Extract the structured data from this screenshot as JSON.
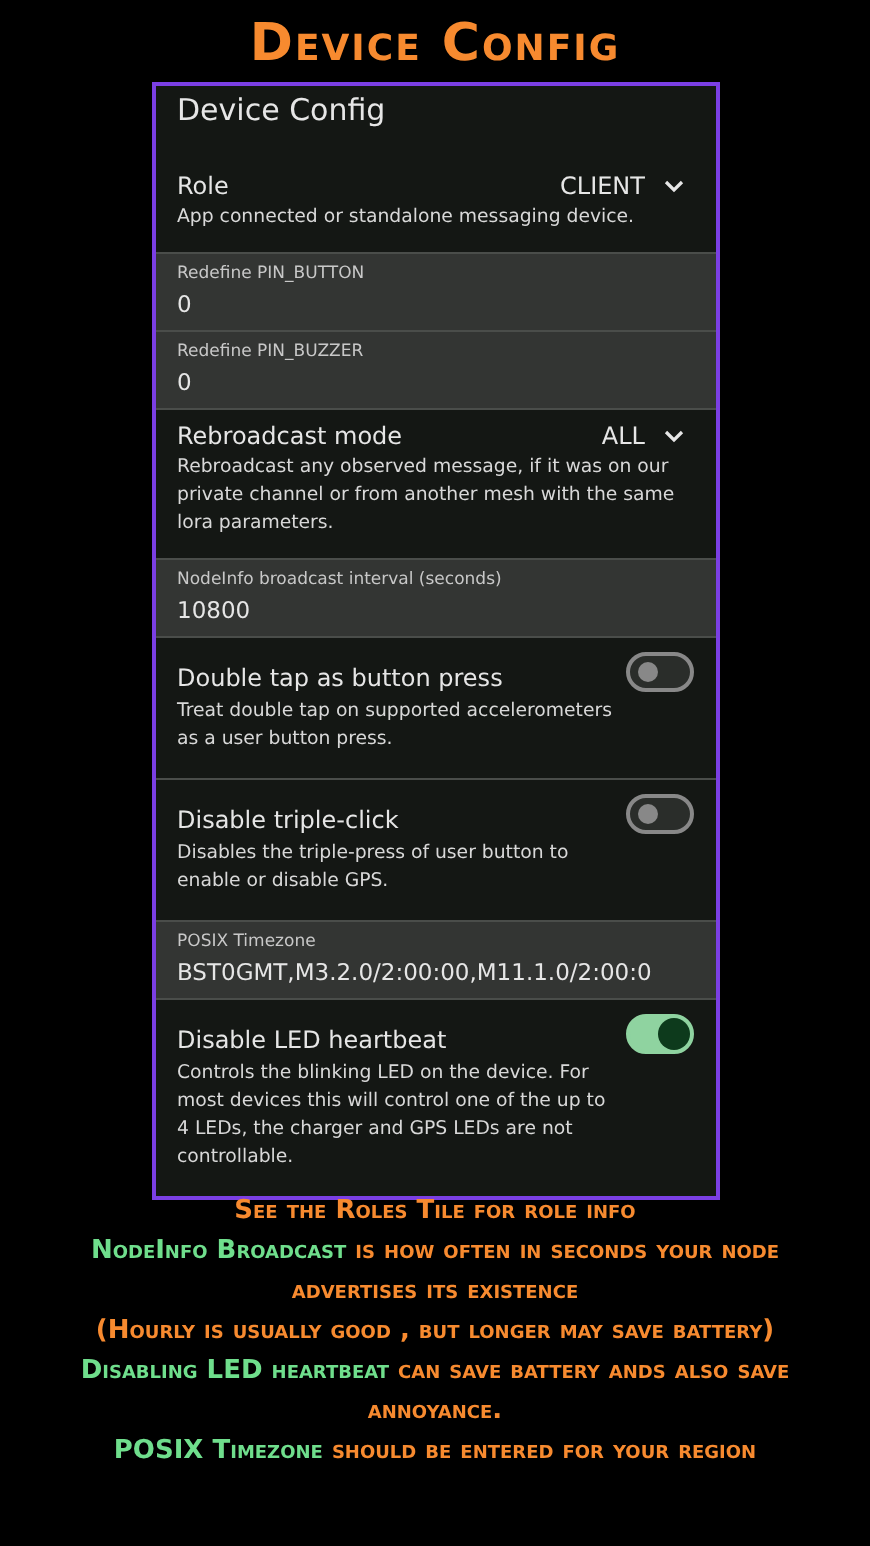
{
  "heading": "Device Config",
  "panel": {
    "title": "Device Config",
    "items": [
      {
        "kind": "dropdown",
        "label": "Role",
        "value": "CLIENT",
        "description": "App connected or standalone messaging device."
      },
      {
        "kind": "field",
        "label": "Redefine PIN_BUTTON",
        "value": "0"
      },
      {
        "kind": "field",
        "label": "Redefine PIN_BUZZER",
        "value": "0"
      },
      {
        "kind": "dropdown",
        "label": "Rebroadcast mode",
        "value": "ALL",
        "description": "Rebroadcast any observed message, if it was on our private channel or from another mesh with the same lora parameters."
      },
      {
        "kind": "field",
        "label": "NodeInfo broadcast interval (seconds)",
        "value": "10800"
      },
      {
        "kind": "toggle",
        "label": "Double tap as button press",
        "description": "Treat double tap on supported accelerometers as a user button press.",
        "on": false
      },
      {
        "kind": "toggle",
        "label": "Disable triple-click",
        "description": "Disables the triple-press of user button to enable or disable GPS.",
        "on": false
      },
      {
        "kind": "field",
        "label": "POSIX Timezone",
        "value": "BST0GMT,M3.2.0/2:00:00,M11.1.0/2:00:0"
      },
      {
        "kind": "toggle",
        "label": "Disable LED heartbeat",
        "description": "Controls the blinking LED on the device. For most devices this will control one of the up to 4 LEDs, the charger and GPS LEDs are not controllable.",
        "on": true
      }
    ]
  },
  "notes": [
    "See the Roles Tile for role info",
    "**NodeInfo Broadcast** is how often in seconds your node advertises its existence",
    "(Hourly is usually good , but longer may save battery)",
    "**Disabling LED heartbeat** can save battery ands also save annoyance.",
    "**POSIX Timezone** should be entered for your region"
  ]
}
